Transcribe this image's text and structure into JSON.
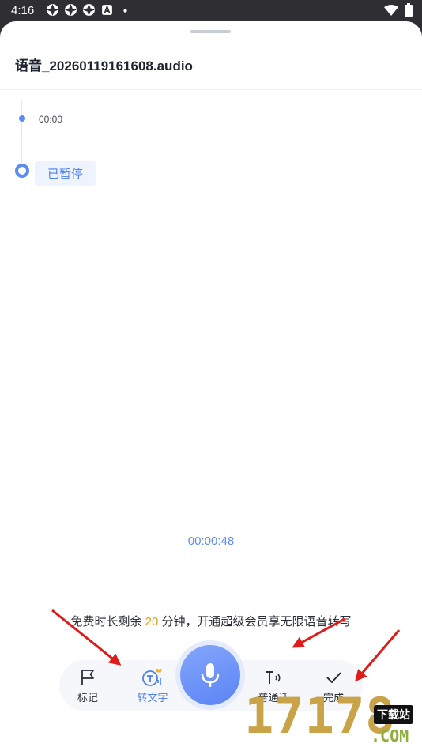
{
  "status_bar": {
    "time": "4:16"
  },
  "sheet": {
    "title": "语音_20260119161608.audio",
    "timeline": {
      "mark_time": "00:00",
      "status": "已暂停"
    },
    "elapsed": "00:00:48",
    "promo": {
      "prefix": "免费时长剩余 ",
      "minutes": "20",
      "suffix": " 分钟，开通超级会员享无限语音转写"
    },
    "toolbar": {
      "mark_label": "标记",
      "transcribe_label": "转文字",
      "language_label": "普通话",
      "done_label": "完成"
    }
  },
  "watermark": {
    "number": "17178",
    "badge": "下载站",
    "domain": ".COM"
  },
  "colors": {
    "accent": "#5b8cf5",
    "highlight": "#e19c2a",
    "arrow": "#e01b1b"
  }
}
